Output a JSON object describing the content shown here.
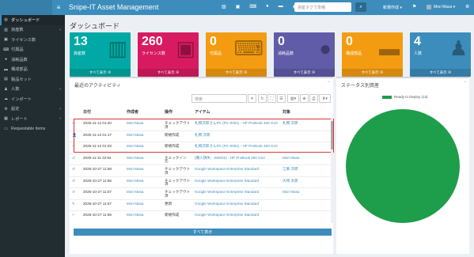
{
  "topbar": {
    "brand": "Snipe-IT Asset Management",
    "search_placeholder": "資産タグで準備",
    "new_menu": "新規作成 ▾",
    "user": "Mori Masa ▾"
  },
  "sidebar": {
    "items": [
      {
        "label": "ダッシュボード",
        "icon": "dashboard-icon"
      },
      {
        "label": "資産数",
        "icon": "barcode-icon"
      },
      {
        "label": "ライセンス数",
        "icon": "floppy-icon"
      },
      {
        "label": "付属品",
        "icon": "keyboard-icon"
      },
      {
        "label": "消耗品数",
        "icon": "tint-icon"
      },
      {
        "label": "構成部品",
        "icon": "hdd-icon"
      },
      {
        "label": "製品セット",
        "icon": "box-icon"
      },
      {
        "label": "人数",
        "icon": "users-icon"
      },
      {
        "label": "インポート",
        "icon": "cloud-upload-icon"
      },
      {
        "label": "設定",
        "icon": "cog-icon"
      },
      {
        "label": "レポート",
        "icon": "chart-icon"
      },
      {
        "label": "Requestable Items",
        "icon": "laptop-icon"
      }
    ]
  },
  "page": {
    "title": "ダッシュボード"
  },
  "tiles": [
    {
      "num": "13",
      "label": "資産数",
      "footer": "すべて表示 ⊕",
      "color": "#00a9a5",
      "icon": "barcode-icon"
    },
    {
      "num": "260",
      "label": "ライセンス数",
      "footer": "すべて表示 ⊕",
      "color": "#d81b60",
      "icon": "floppy-icon"
    },
    {
      "num": "0",
      "label": "付属品",
      "footer": "すべて表示 ⊕",
      "color": "#f39c12",
      "icon": "keyboard-icon"
    },
    {
      "num": "0",
      "label": "消耗品数",
      "footer": "すべて表示 ⊕",
      "color": "#605ca8",
      "icon": "tint-icon"
    },
    {
      "num": "0",
      "label": "構成部品",
      "footer": "すべて表示 ⊕",
      "color": "#f39c12",
      "icon": "hdd-icon"
    },
    {
      "num": "4",
      "label": "人数",
      "footer": "すべて表示 ⊕",
      "color": "#3c8dbc",
      "icon": "users-icon"
    }
  ],
  "activity": {
    "title": "最近のアクティビティ",
    "search_placeholder": "検索",
    "columns": [
      "日付",
      "作成者",
      "操作",
      "アイテム",
      "対象"
    ],
    "rows": [
      {
        "icon": "↺",
        "date": "2025-11-12 01:20",
        "by": "Mori Masa",
        "action": "チェックアウト\n済",
        "item": "札幌次郎さんPC (PC-0001) - HP ProBook 450 G10",
        "target": "札幌 次郎"
      },
      {
        "icon": "👤",
        "date": "2025-11-12 01:17",
        "by": "Mori Masa",
        "action": "新規作成",
        "item": "札幌 次郎",
        "target": ""
      },
      {
        "icon": "+",
        "date": "2025-11-12 01:03",
        "by": "Mori Masa",
        "action": "新規作成",
        "item": "札幌次郎さんPC (PC-0001) - HP ProBook 450 G10",
        "target": ""
      },
      {
        "icon": "↺",
        "date": "2025-11-11 22:54",
        "by": "Mori Masa",
        "action": "チェックイン\n元",
        "item": "(購入損失：W0001) - HP ProBook 450 G10",
        "target": "Mori Masa"
      },
      {
        "icon": "↺",
        "date": "2025-10-27 11:58",
        "by": "Mori Masa",
        "action": "チェックアウト\n済",
        "item": "Google Workspace Enterprise Standard",
        "target": "江東 次郎"
      },
      {
        "icon": "↺",
        "date": "2025-10-27 11:56",
        "by": "Mori Masa",
        "action": "チェックアウト\n済",
        "item": "Google Workspace Enterprise Standard",
        "target": "大崎 太郎"
      },
      {
        "icon": "↺",
        "date": "2025-10-27 11:57",
        "by": "Mori Masa",
        "action": "チェックアウト\n済",
        "item": "Google Workspace Enterprise Standard",
        "target": "Mori Masa"
      },
      {
        "icon": "✎",
        "date": "2025-10-27 11:57",
        "by": "Mori Masa",
        "action": "更新",
        "item": "Google Workspace Enterprise Standard",
        "target": ""
      },
      {
        "icon": "+",
        "date": "2025-10-27 11:56",
        "by": "Mori Masa",
        "action": "新規作成",
        "item": "Google Workspace Enterprise Standard",
        "target": ""
      }
    ],
    "show_all": "すべて表示"
  },
  "status_box": {
    "title": "ステータス別資産",
    "legend": "Ready to Deploy (13)",
    "color": "#1e9e4a"
  }
}
